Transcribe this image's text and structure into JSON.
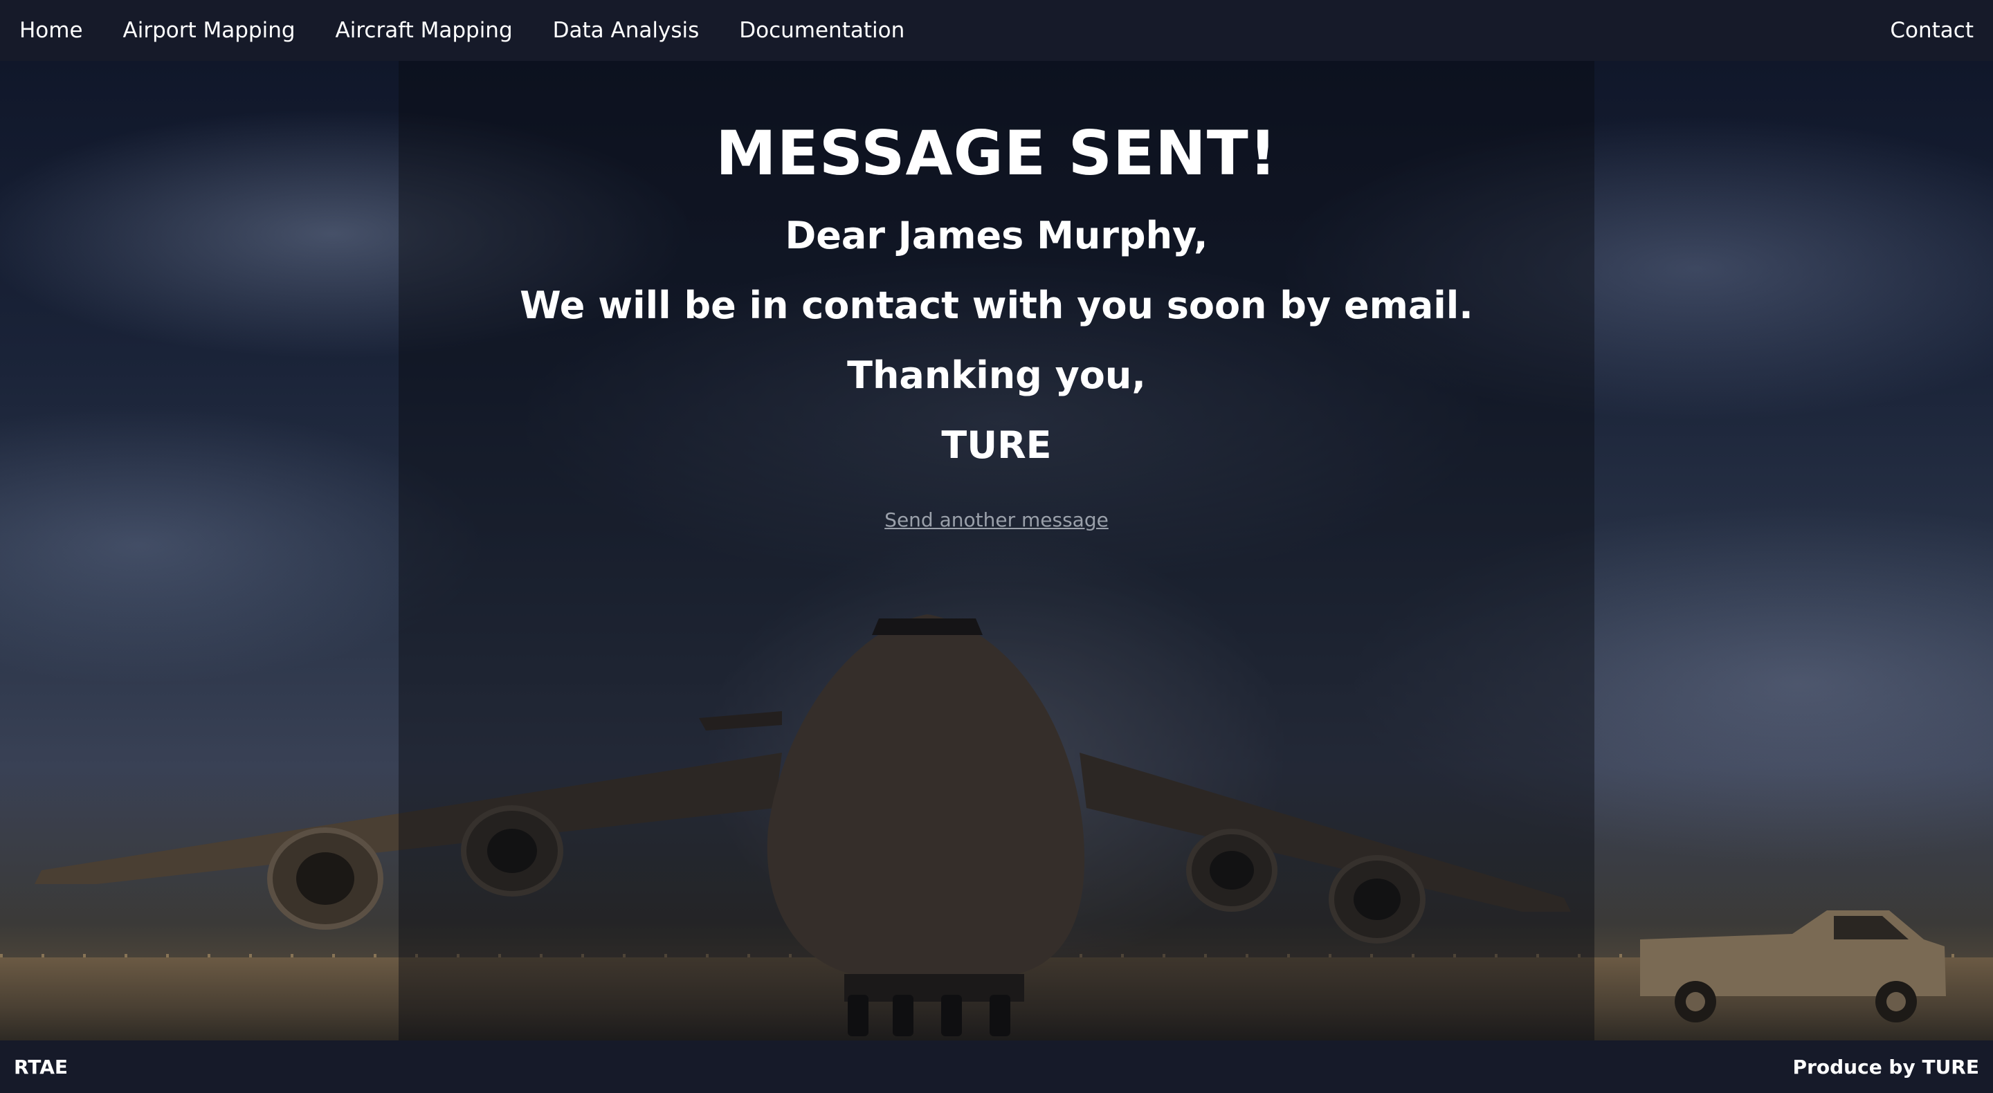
{
  "nav": {
    "items": [
      {
        "label": "Home"
      },
      {
        "label": "Airport Mapping"
      },
      {
        "label": "Aircraft Mapping"
      },
      {
        "label": "Data Analysis"
      },
      {
        "label": "Documentation"
      }
    ],
    "contact_label": "Contact"
  },
  "message": {
    "title": "MESSAGE SENT!",
    "greeting": "Dear James Murphy,",
    "body": "We will be in contact with you soon by email.",
    "closing": "Thanking you,",
    "signature": "TURE",
    "link_label": "Send another message"
  },
  "footer": {
    "left": "RTAE",
    "right": "Produce by TURE"
  },
  "colors": {
    "nav_bg": "#161a29",
    "text": "#ffffff",
    "link_muted": "#9aa0aa"
  }
}
